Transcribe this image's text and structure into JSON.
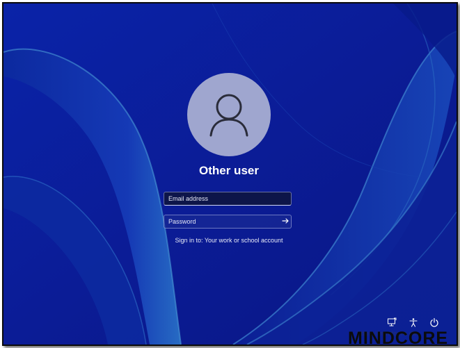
{
  "user": {
    "name": "Other user"
  },
  "login": {
    "email_placeholder": "Email address",
    "password_placeholder": "Password",
    "sign_in_to": "Sign in to: Your work or school account"
  },
  "tray": {
    "icons": [
      "network-icon",
      "accessibility-icon",
      "power-icon"
    ]
  },
  "watermark": "https://mindcore.dk",
  "logo": "MINDCORE",
  "colors": {
    "background": "#0a1f9a",
    "avatar": "#9fa6cf",
    "text": "#ffffff"
  }
}
